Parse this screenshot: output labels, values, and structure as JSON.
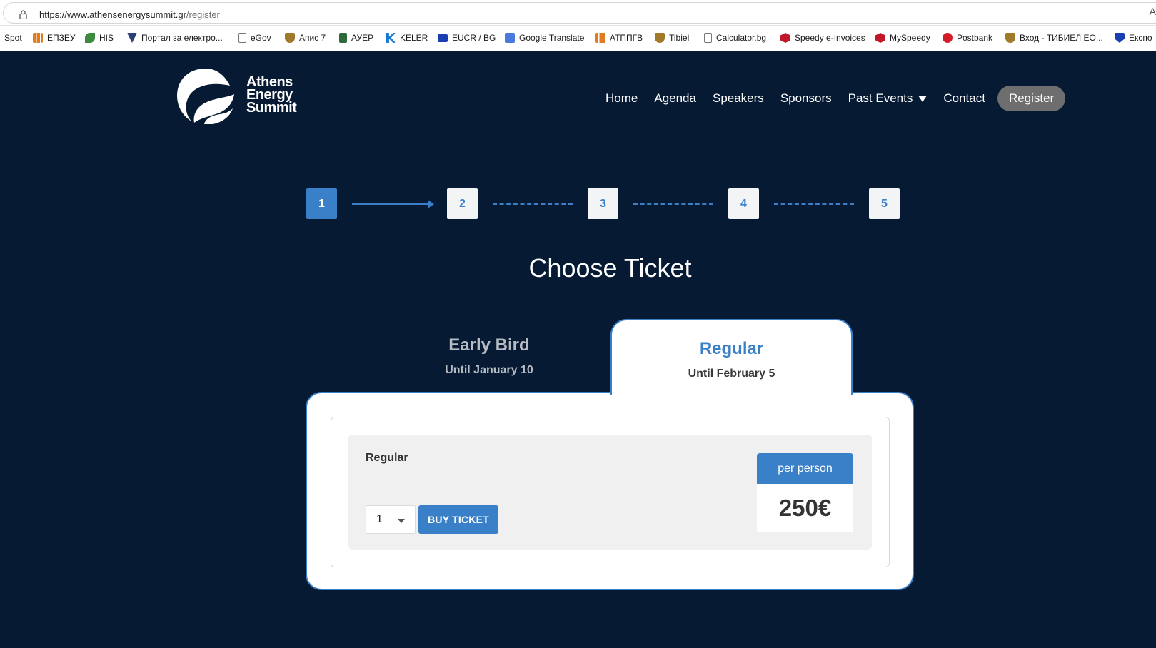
{
  "browser": {
    "url_main": "https://www.athensenergysummit.gr",
    "url_path": "/register",
    "reader_icon": "A",
    "bookmarks": [
      {
        "label": "Spot",
        "icon": "none",
        "color": ""
      },
      {
        "label": "ЕПЗЕУ",
        "icon": "chart-icon",
        "color": "#e07b22"
      },
      {
        "label": "HIS",
        "icon": "leaf-icon",
        "color": "#3b8a3e"
      },
      {
        "label": "Портал за електро...",
        "icon": "check-icon",
        "color": "#2a3f7a"
      },
      {
        "label": "eGov",
        "icon": "page-icon",
        "color": "#777777"
      },
      {
        "label": "Апис 7",
        "icon": "shield-icon",
        "color": "#a07a2a"
      },
      {
        "label": "АУЕР",
        "icon": "doc-icon",
        "color": "#2f6b3a"
      },
      {
        "label": "KELER",
        "icon": "k-icon",
        "color": "#1976d2"
      },
      {
        "label": "EUCR / BG",
        "icon": "eu-flag-icon",
        "color": "#1a3fb0"
      },
      {
        "label": "Google Translate",
        "icon": "translate-icon",
        "color": "#4a7bdc"
      },
      {
        "label": "АТППГВ",
        "icon": "chart-icon",
        "color": "#e07b22"
      },
      {
        "label": "Tibiel",
        "icon": "shield-icon",
        "color": "#a07a2a"
      },
      {
        "label": "Calculator.bg",
        "icon": "page-icon",
        "color": "#777777"
      },
      {
        "label": "Speedy e-Invoices",
        "icon": "box-icon",
        "color": "#c0172b"
      },
      {
        "label": "MySpeedy",
        "icon": "box-icon",
        "color": "#c0172b"
      },
      {
        "label": "Postbank",
        "icon": "circle-icon",
        "color": "#d21c2a"
      },
      {
        "label": "Вход - ТИБИЕЛ ЕО...",
        "icon": "bg-icon",
        "color": "#a07a2a"
      },
      {
        "label": "Експо",
        "icon": "v-icon",
        "color": "#1a3fb0"
      }
    ]
  },
  "site": {
    "logo": [
      "Athens",
      "Energy",
      "Summit"
    ],
    "nav": {
      "home": "Home",
      "agenda": "Agenda",
      "speakers": "Speakers",
      "sponsors": "Sponsors",
      "past_events": "Past Events",
      "contact": "Contact",
      "register": "Register"
    }
  },
  "steps": [
    "1",
    "2",
    "3",
    "4",
    "5"
  ],
  "active_step": 1,
  "page_title": "Choose Ticket",
  "tabs": {
    "early": {
      "title": "Early Bird",
      "subtitle": "Until January 10"
    },
    "regular": {
      "title": "Regular",
      "subtitle": "Until February 5"
    }
  },
  "ticket": {
    "name": "Regular",
    "quantity": "1",
    "buy_label": "BUY TICKET",
    "price_header": "per person",
    "price": "250€"
  },
  "colors": {
    "background": "#061a33",
    "accent": "#3a80c9",
    "register_pill": "#6e6e6e"
  }
}
